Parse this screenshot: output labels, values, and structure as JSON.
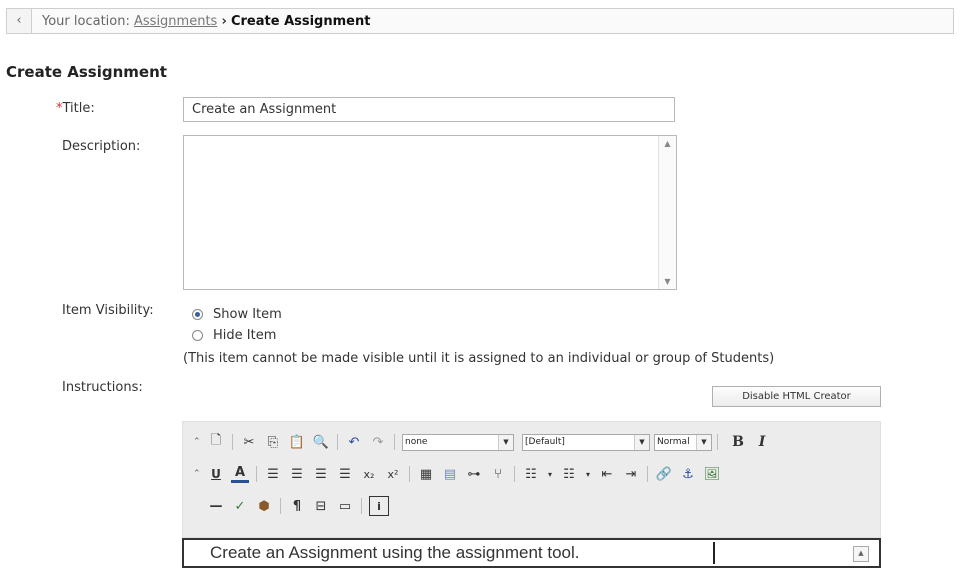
{
  "breadcrumb": {
    "prefix": "Your location:",
    "link": "Assignments",
    "separator": "›",
    "current": "Create Assignment"
  },
  "page_title": "Create Assignment",
  "form": {
    "title_required_mark": "*",
    "title_label": "Title:",
    "title_value": "Create an Assignment",
    "description_label": "Description:",
    "description_value": "",
    "visibility_label": "Item Visibility:",
    "visibility_options": [
      {
        "label": "Show Item",
        "selected": true
      },
      {
        "label": "Hide Item",
        "selected": false
      }
    ],
    "visibility_note": "(This item cannot be made visible until it is assigned to an individual or group of Students)",
    "instructions_label": "Instructions:",
    "disable_html_button": "Disable HTML Creator"
  },
  "editor": {
    "style_select": "none",
    "font_select": "[Default]",
    "size_select": "Normal",
    "bold_label": "B",
    "italic_label": "I",
    "content": "Create an Assignment using the assignment tool."
  },
  "colors": {
    "accent_blue": "#3a5fa0",
    "required_red": "#d33333",
    "toolbar_bg": "#ececec"
  }
}
